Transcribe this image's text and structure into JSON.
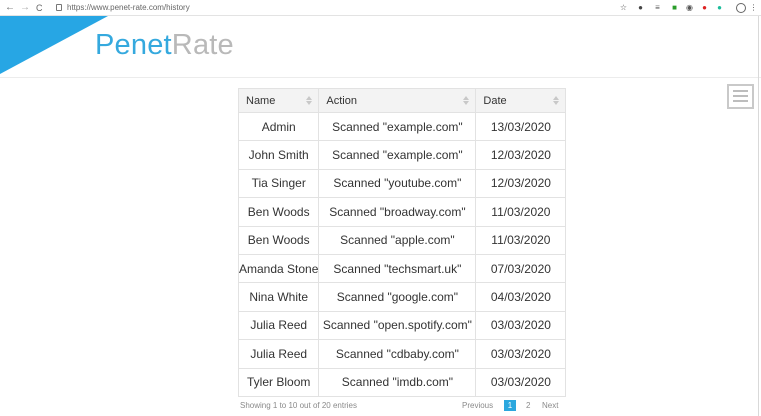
{
  "browser": {
    "back": "←",
    "forward": "→",
    "reload": "C",
    "url": "https://www.penet-rate.com/history",
    "extensions": [
      "☆",
      "●",
      "≡",
      "■",
      "◉",
      "●",
      "●",
      "⋮"
    ]
  },
  "brand": {
    "part1": "Penet",
    "part2": "Rate"
  },
  "table": {
    "headers": [
      "Name",
      "Action",
      "Date"
    ],
    "rows": [
      [
        "Admin",
        "Scanned \"example.com\"",
        "13/03/2020"
      ],
      [
        "John Smith",
        "Scanned \"example.com\"",
        "12/03/2020"
      ],
      [
        "Tia Singer",
        "Scanned \"youtube.com\"",
        "12/03/2020"
      ],
      [
        "Ben Woods",
        "Scanned \"broadway.com\"",
        "11/03/2020"
      ],
      [
        "Ben Woods",
        "Scanned \"apple.com\"",
        "11/03/2020"
      ],
      [
        "Amanda Stone",
        "Scanned \"techsmart.uk\"",
        "07/03/2020"
      ],
      [
        "Nina White",
        "Scanned \"google.com\"",
        "04/03/2020"
      ],
      [
        "Julia Reed",
        "Scanned \"open.spotify.com\"",
        "03/03/2020"
      ],
      [
        "Julia Reed",
        "Scanned \"cdbaby.com\"",
        "03/03/2020"
      ],
      [
        "Tyler Bloom",
        "Scanned \"imdb.com\"",
        "03/03/2020"
      ]
    ]
  },
  "pagination": {
    "info": "Showing 1 to 10 out of 20 entries",
    "previous": "Previous",
    "pages": [
      "1",
      "2"
    ],
    "next": "Next"
  },
  "colors": {
    "accent": "#27a6e4",
    "logo_secondary": "#b9b9b9"
  }
}
